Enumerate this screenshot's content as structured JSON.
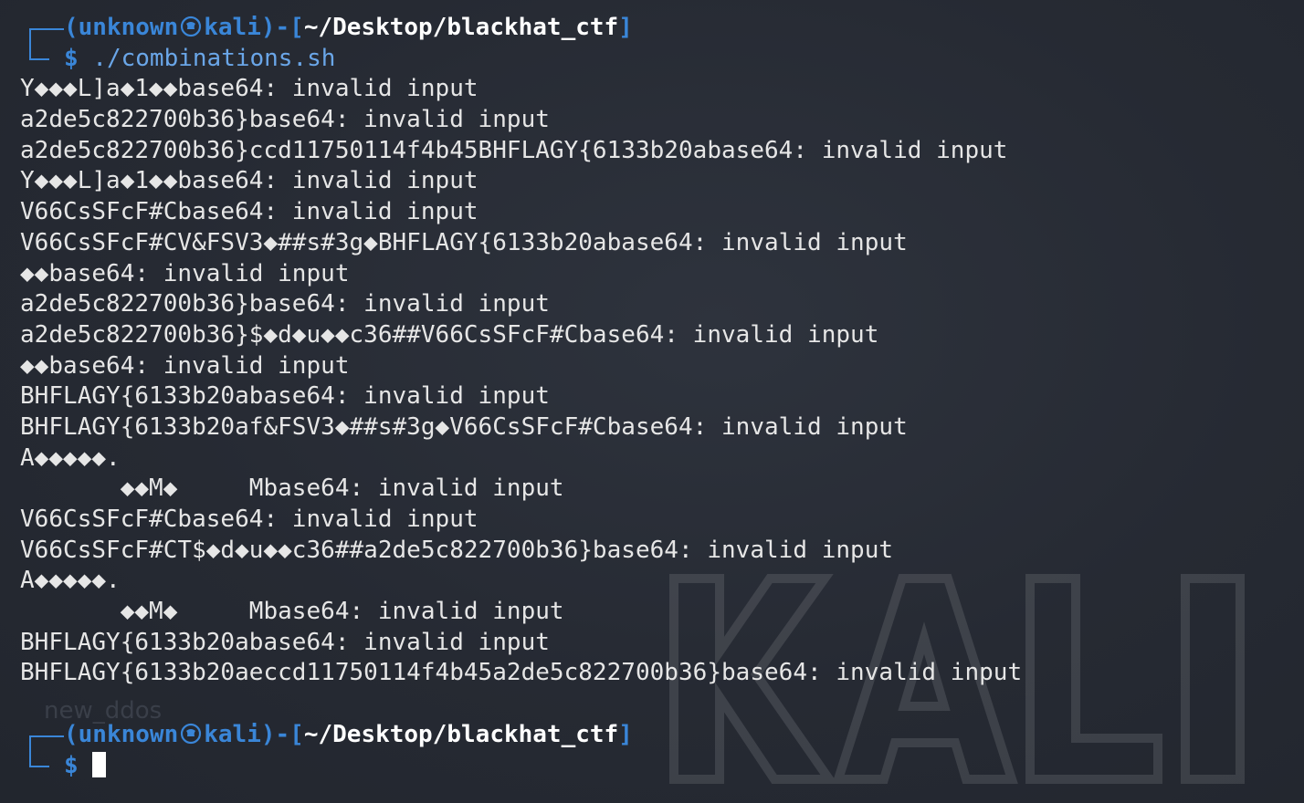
{
  "prompt": {
    "user": "unknown",
    "host": "kali",
    "path": "~/Desktop/blackhat_ctf",
    "symbol": "$"
  },
  "command": "./combinations.sh",
  "output_lines": [
    "Y◆◆◆L]a◆1◆◆base64: invalid input",
    "a2de5c822700b36}base64: invalid input",
    "a2de5c822700b36}ccd11750114f4b45BHFLAGY{6133b20abase64: invalid input",
    "Y◆◆◆L]a◆1◆◆base64: invalid input",
    "V66CsSFcF#Cbase64: invalid input",
    "V66CsSFcF#CV&FSV3◆##s#3g◆BHFLAGY{6133b20abase64: invalid input",
    "◆◆base64: invalid input",
    "a2de5c822700b36}base64: invalid input",
    "a2de5c822700b36}$◆d◆u◆◆c36##V66CsSFcF#Cbase64: invalid input",
    "◆◆base64: invalid input",
    "BHFLAGY{6133b20abase64: invalid input",
    "BHFLAGY{6133b20af&FSV3◆##s#3g◆V66CsSFcF#Cbase64: invalid input",
    "A◆◆◆◆◆.",
    "       ◆◆M◆     Mbase64: invalid input",
    "V66CsSFcF#Cbase64: invalid input",
    "V66CsSFcF#CT$◆d◆u◆◆c36##a2de5c822700b36}base64: invalid input",
    "A◆◆◆◆◆.",
    "       ◆◆M◆     Mbase64: invalid input",
    "BHFLAGY{6133b20abase64: invalid input",
    "BHFLAGY{6133b20aeccd11750114f4b45a2de5c822700b36}base64: invalid input"
  ],
  "background": {
    "watermark": "KALI",
    "desktop_label": "new_ddos"
  },
  "colors": {
    "background": "#262a33",
    "prompt_accent": "#3a86d8",
    "text": "#e6e6e6"
  }
}
